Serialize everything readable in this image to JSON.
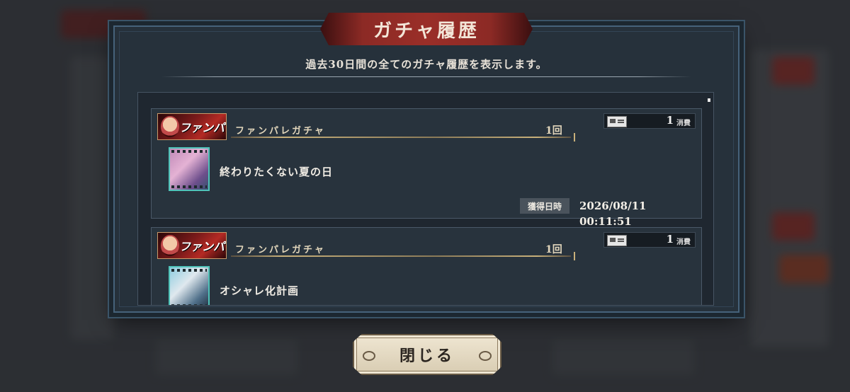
{
  "dialog": {
    "title": "ガチャ履歴",
    "subtitle": "過去30日間の全てのガチャ履歴を表示します。"
  },
  "entries": [
    {
      "banner_label": "ファンパレ",
      "gacha_name": "ファンパレガチャ",
      "count": "1回",
      "cost_icon": "ticket-icon",
      "cost_amount": "1",
      "cost_unit": "消費",
      "card_name": "終わりたくない夏の日",
      "acquired_label": "獲得日時",
      "acquired_at": "2026/08/11 00:11:51"
    },
    {
      "banner_label": "ファンパレ",
      "gacha_name": "ファンパレガチャ",
      "count": "1回",
      "cost_icon": "ticket-icon",
      "cost_amount": "1",
      "cost_unit": "消費",
      "card_name": "オシャレ化計画"
    }
  ],
  "close_button": {
    "label": "閉じる"
  },
  "colors": {
    "panel_bg": "#26313b",
    "title_banner": "#9a2e28",
    "gold_accent": "#c8b07a",
    "rarity_frame": "#4fc3b9",
    "button_bg": "#efe6d2"
  }
}
